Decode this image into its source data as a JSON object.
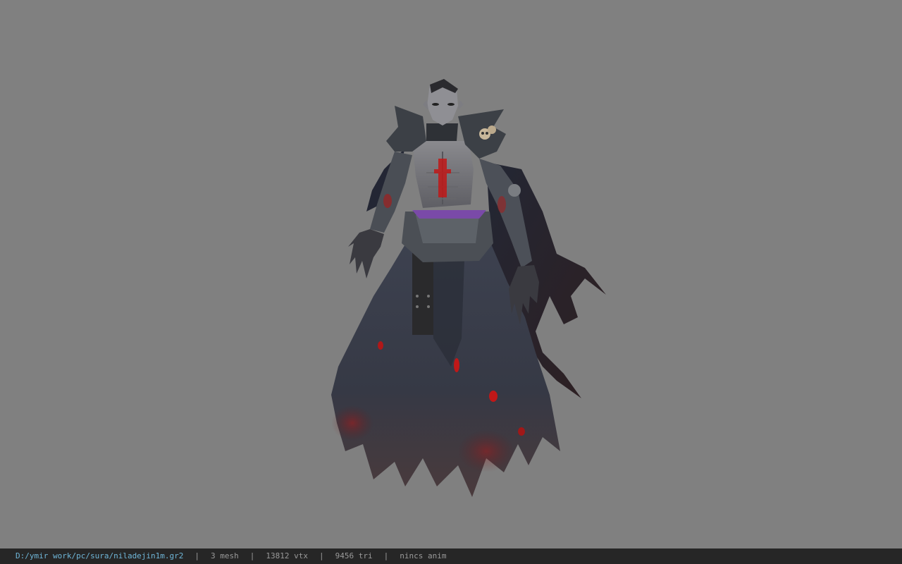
{
  "viewport": {
    "background": "#808080",
    "model": "character-model"
  },
  "status_bar": {
    "path": "D:/ymir work/pc/sura/niladejin1m.gr2",
    "separator": "|",
    "mesh": "3 mesh",
    "vtx": "13812 vtx",
    "tri": "9456 tri",
    "anim": "nincs anim",
    "path_color": "#6fb6d8"
  }
}
